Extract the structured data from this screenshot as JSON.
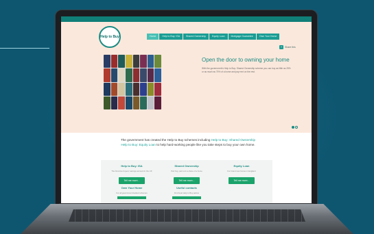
{
  "site": {
    "logo_text": "Help to Buy",
    "nav": [
      "Home",
      "Help to Buy: ISA",
      "Shared Ownership",
      "Equity Loan",
      "Mortgage Guarantee",
      "Own Your Home"
    ],
    "share_label": "Share this"
  },
  "hero": {
    "headline": "Open the door to owning your home",
    "subtext": "With the government's Help to Buy: Shared Ownership scheme you can buy as little as 25% or as much as 75% of a home and pay rent on the rest."
  },
  "intro": {
    "line1_before": "The government has created the Help to Buy schemes including ",
    "line1_link": "Help to Buy: Shared Ownership",
    "line2_link": "Help to Buy: Equity Loan",
    "line2_after": " to help hard-working people like you take steps to buy your own home."
  },
  "schemes": [
    {
      "title": "Help to Buy: ISA",
      "desc": "The first-time buyers' savings account in the UK",
      "button": "Tell me more..."
    },
    {
      "title": "Shared Ownership",
      "desc": "Part buy, part rent a share of a home",
      "button": "Tell me more..."
    },
    {
      "title": "Equity Loan",
      "desc": "For brand new homes in England",
      "button": "Tell me more..."
    },
    {
      "title": "Own Your Home",
      "desc": "For all government-backed schemes"
    },
    {
      "title": "Useful contacts",
      "desc": "Find local Help to Buy advice"
    }
  ],
  "door_colors": [
    "#2a3c66",
    "#9a2c2c",
    "#1f5c5a",
    "#c9b23a",
    "#3d3d3d",
    "#7a2f52",
    "#2c5e8e",
    "#6b8a3a",
    "#b03a2e",
    "#27496d",
    "#e0d6c2",
    "#2e6b4c",
    "#8e2f2f",
    "#3a4a6b",
    "#5a2a4a",
    "#2d5f9a",
    "#1e3a5f",
    "#a34a2a",
    "#d2c5a0",
    "#2a6e7a",
    "#4a2f2f",
    "#2c3e8e",
    "#8b8b2a",
    "#a02c3c",
    "#3e5a2a",
    "#2a2a4a",
    "#c24a3a",
    "#1a4a6a",
    "#7a5a2a",
    "#2a6a5a",
    "#c0c0c8",
    "#5a1e3a"
  ]
}
